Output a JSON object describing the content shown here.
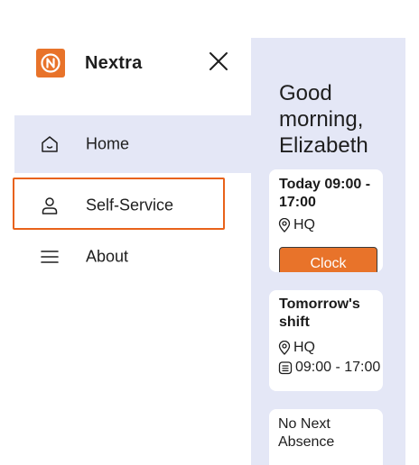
{
  "app": {
    "name": "Nextra",
    "accent": "#e8732a",
    "nav_bg": "#e4e7f6"
  },
  "nav": {
    "items": [
      {
        "label": "Home",
        "icon": "home-icon",
        "active": true
      },
      {
        "label": "Self-Service",
        "icon": "user-icon",
        "active": false
      },
      {
        "label": "About",
        "icon": "menu-icon",
        "active": false
      }
    ]
  },
  "main": {
    "greeting": "Good morning, Elizabeth",
    "today_card": {
      "title": "Today 09:00 - 17:00",
      "location": "HQ",
      "button": "Clock"
    },
    "tomorrow_card": {
      "title": "Tomorrow's shift",
      "location": "HQ",
      "time": "09:00 - 17:00"
    },
    "absence_card": {
      "text": "No Next Absence"
    }
  }
}
